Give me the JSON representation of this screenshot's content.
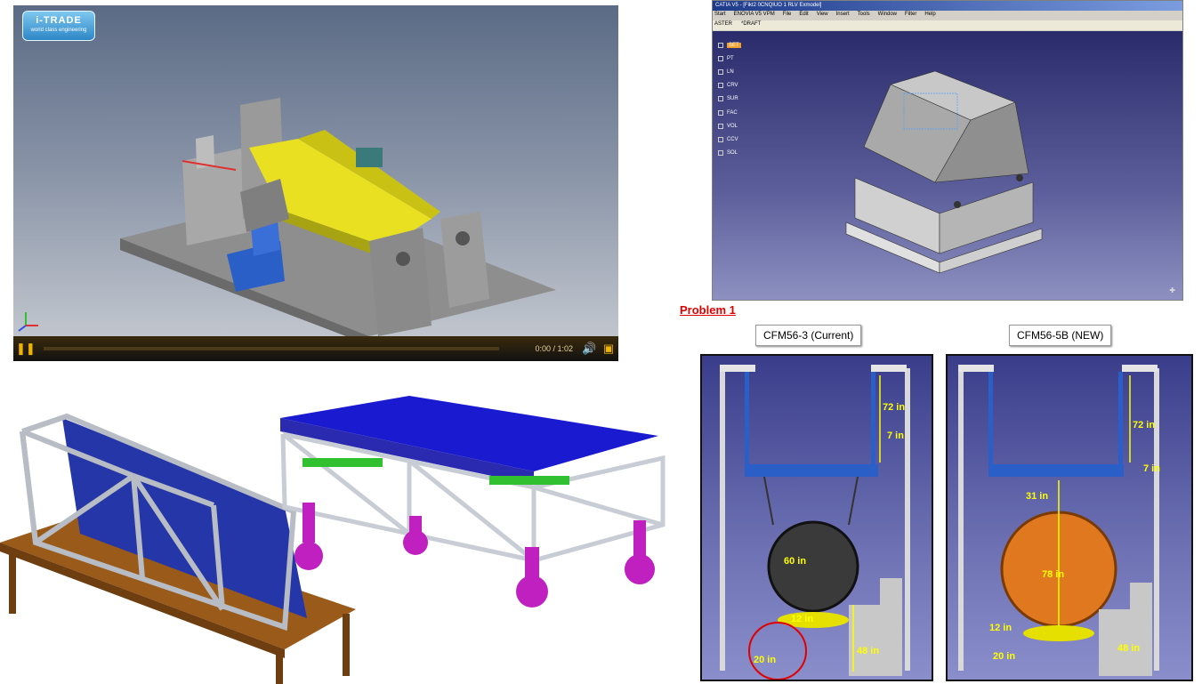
{
  "video_player": {
    "logo": "i-TRADE",
    "logo_sub": "world class engineering",
    "time": "0:00 / 1:02",
    "progress_fraction": 0.0,
    "icons": [
      "pause-icon",
      "volume-icon",
      "fullscreen-icon"
    ],
    "colors": {
      "accent": "#f0b400",
      "part": "#e8e020",
      "clamp": "#2a5fc8"
    }
  },
  "catia": {
    "title": "CATIA V5 - [Fikt2 0CNQIUO 1 RLV Exmodel]",
    "menu": [
      "Start",
      "ENOVIA V5 VPM",
      "File",
      "Edit",
      "View",
      "Insert",
      "Tools",
      "Window",
      "Filter",
      "Help"
    ],
    "tabs": [
      "ASTER",
      "*DRAFT"
    ],
    "tree": [
      "SET",
      "PT",
      "LN",
      "CRV",
      "SUR",
      "FAC",
      "VOL",
      "CCV",
      "SOL"
    ]
  },
  "problem": {
    "title": "Problem 1",
    "current_label": "CFM56-3 (Current)",
    "new_label": "CFM56-5B (NEW)",
    "current_dims": {
      "top": "72 in",
      "mid": "7 in",
      "engine": "60 in",
      "ground_gap": "12 in",
      "floor": "20 in",
      "stairs": "48 in"
    },
    "new_dims": {
      "top": "72 in",
      "mid": "7 in",
      "upper": "31 in",
      "engine": "78 in",
      "ground_gap": "12 in",
      "floor": "20 in",
      "stairs": "48 in"
    },
    "colors": {
      "engine_current": "#3a3a3a",
      "engine_new": "#e07820",
      "dimension": "#ffff00",
      "highlight": "#e00000"
    }
  }
}
